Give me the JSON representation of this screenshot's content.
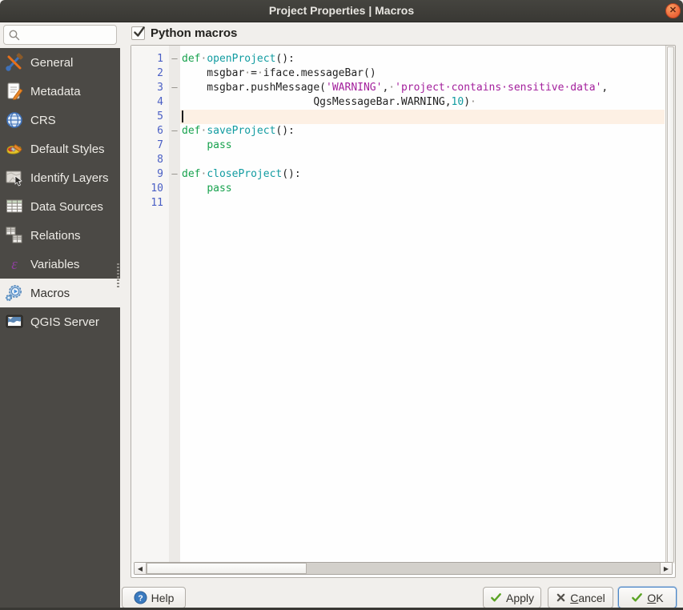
{
  "window": {
    "title": "Project Properties | Macros",
    "titlebar_bg": "#3c3a36",
    "close_button_color": "#ef6b3d"
  },
  "sidebar": {
    "search": {
      "placeholder": "",
      "icon": "magnifier"
    },
    "items": [
      {
        "label": "General",
        "icon": "general",
        "selected": false
      },
      {
        "label": "Metadata",
        "icon": "metadata",
        "selected": false
      },
      {
        "label": "CRS",
        "icon": "crs",
        "selected": false
      },
      {
        "label": "Default Styles",
        "icon": "styles",
        "selected": false
      },
      {
        "label": "Identify Layers",
        "icon": "identify",
        "selected": false
      },
      {
        "label": "Data Sources",
        "icon": "datasources",
        "selected": false
      },
      {
        "label": "Relations",
        "icon": "relations",
        "selected": false
      },
      {
        "label": "Variables",
        "icon": "variables",
        "selected": false
      },
      {
        "label": "Macros",
        "icon": "macros",
        "selected": true
      },
      {
        "label": "QGIS Server",
        "icon": "qgisserver",
        "selected": false
      }
    ]
  },
  "main": {
    "checkbox": {
      "label": "Python macros",
      "checked": true
    }
  },
  "editor": {
    "language": "python",
    "current_line": 5,
    "colors": {
      "keyword": "#18a24e",
      "function": "#129ca1",
      "string": "#a31f9c",
      "number": "#129ca1",
      "default": "#232323",
      "line_number": "#4a5fc5",
      "current_line_bg": "#fdf0e4"
    },
    "lines": [
      {
        "n": 1,
        "fold": true,
        "current": false,
        "seg": [
          [
            "kw",
            "def"
          ],
          [
            "ws",
            "·"
          ],
          [
            "fn",
            "openProject"
          ],
          [
            "df",
            "():"
          ]
        ]
      },
      {
        "n": 2,
        "fold": false,
        "current": false,
        "seg": [
          [
            "df",
            "    msgbar"
          ],
          [
            "ws",
            "·"
          ],
          [
            "df",
            "="
          ],
          [
            "ws",
            "·"
          ],
          [
            "df",
            "iface.messageBar()"
          ]
        ]
      },
      {
        "n": 3,
        "fold": true,
        "current": false,
        "seg": [
          [
            "df",
            "    msgbar.pushMessage("
          ],
          [
            "st",
            "'WARNING'"
          ],
          [
            "df",
            ","
          ],
          [
            "ws",
            "·"
          ],
          [
            "st",
            "'project·contains·sensitive·data'"
          ],
          [
            "df",
            ","
          ]
        ]
      },
      {
        "n": 4,
        "fold": false,
        "current": false,
        "seg": [
          [
            "df",
            "                     QgsMessageBar.WARNING,"
          ],
          [
            "nu",
            "10"
          ],
          [
            "df",
            ")"
          ],
          [
            "ws",
            "·"
          ]
        ]
      },
      {
        "n": 5,
        "fold": false,
        "current": true,
        "seg": []
      },
      {
        "n": 6,
        "fold": true,
        "current": false,
        "seg": [
          [
            "kw",
            "def"
          ],
          [
            "ws",
            "·"
          ],
          [
            "fn",
            "saveProject"
          ],
          [
            "df",
            "():"
          ]
        ]
      },
      {
        "n": 7,
        "fold": false,
        "current": false,
        "seg": [
          [
            "df",
            "    "
          ],
          [
            "kw",
            "pass"
          ]
        ]
      },
      {
        "n": 8,
        "fold": false,
        "current": false,
        "seg": []
      },
      {
        "n": 9,
        "fold": true,
        "current": false,
        "seg": [
          [
            "kw",
            "def"
          ],
          [
            "ws",
            "·"
          ],
          [
            "fn",
            "closeProject"
          ],
          [
            "df",
            "():"
          ]
        ]
      },
      {
        "n": 10,
        "fold": false,
        "current": false,
        "seg": [
          [
            "df",
            "    "
          ],
          [
            "kw",
            "pass"
          ]
        ]
      },
      {
        "n": 11,
        "fold": false,
        "current": false,
        "seg": []
      }
    ]
  },
  "buttons": {
    "help": {
      "label": "Help"
    },
    "apply": {
      "label": "Apply"
    },
    "cancel": {
      "mnemonic": "C",
      "rest": "ancel"
    },
    "ok": {
      "mnemonic": "O",
      "rest": "K"
    }
  }
}
